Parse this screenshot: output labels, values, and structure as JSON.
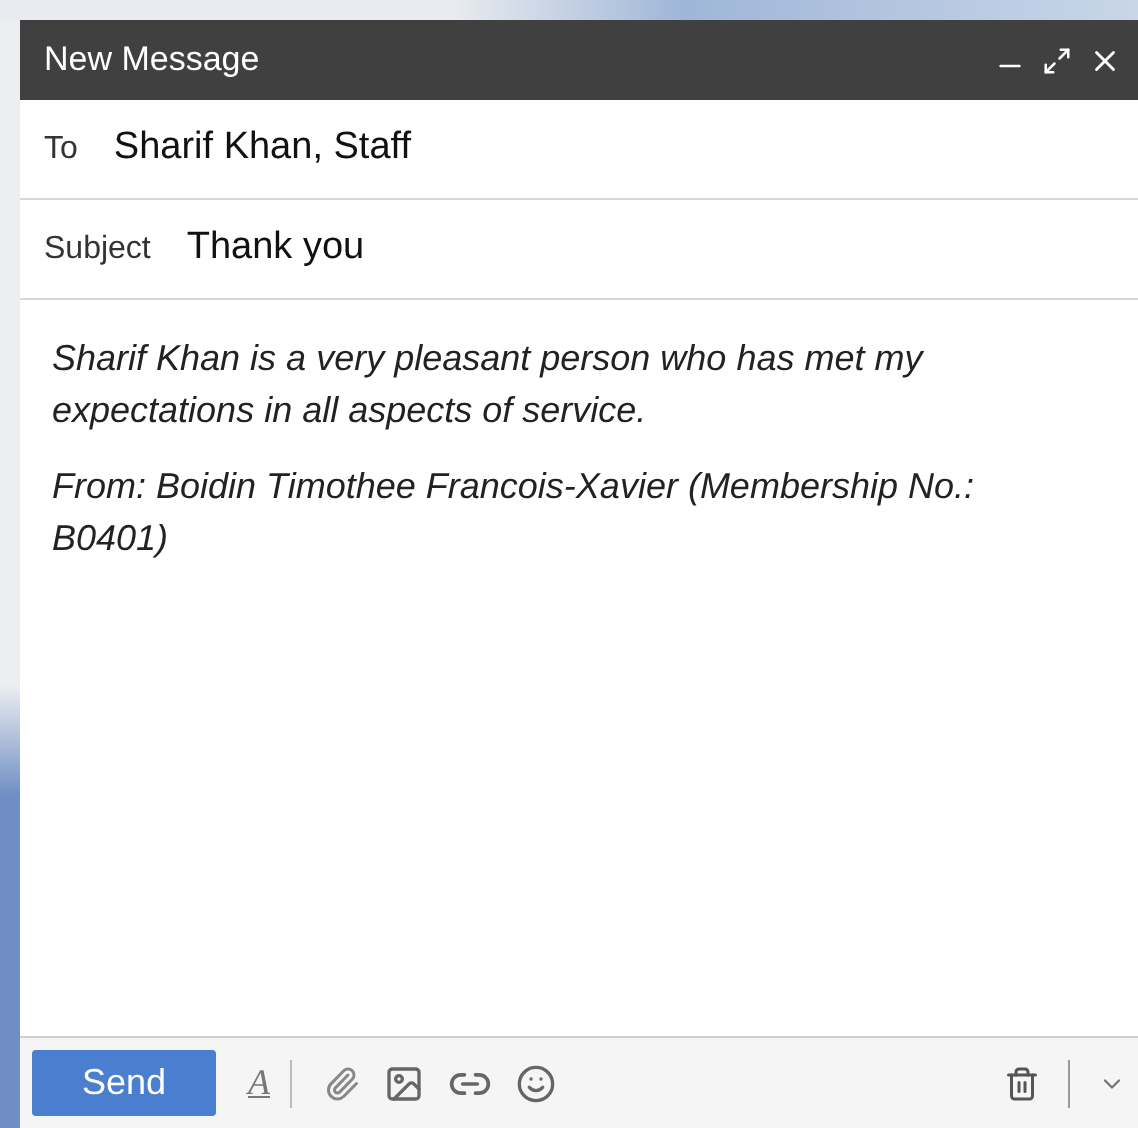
{
  "window": {
    "title": "New Message"
  },
  "to": {
    "label": "To",
    "value": "Sharif Khan, Staff"
  },
  "subject": {
    "label": "Subject",
    "value": "Thank you"
  },
  "body": [
    "Sharif Khan is a very pleasant person who has met my expectations in all aspects of service.",
    "From: Boidin Timothee Francois-Xavier (Membership No.: B0401)"
  ],
  "toolbar": {
    "send": "Send",
    "format": "A"
  }
}
